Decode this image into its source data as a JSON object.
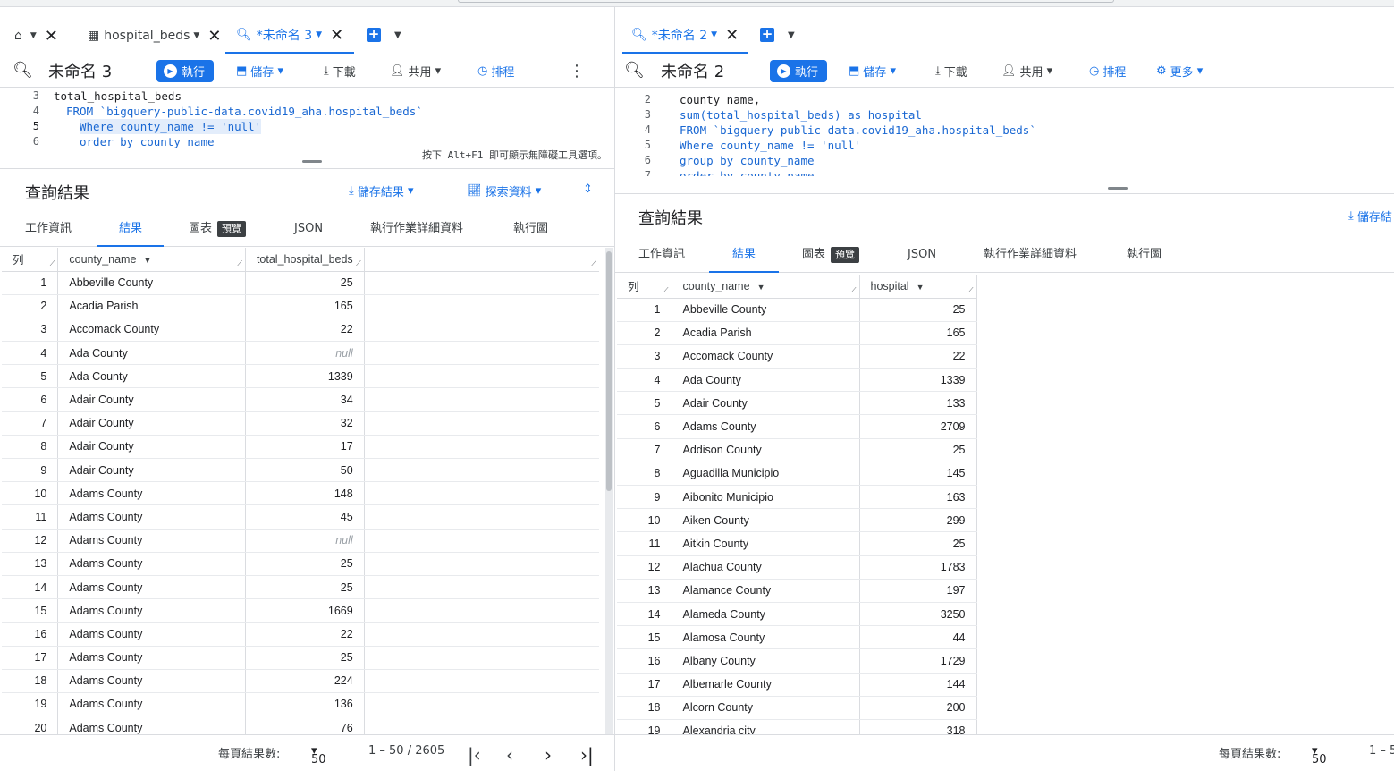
{
  "left": {
    "tabs": [
      {
        "label": "hospital_beds"
      },
      {
        "label": "*未命名 3"
      }
    ],
    "query_title": "未命名 3",
    "toolbar": {
      "run": "執行",
      "save": "儲存",
      "download": "下載",
      "share": "共用",
      "schedule": "排程"
    },
    "code": [
      {
        "n": "3",
        "t": "total_hospital_beds"
      },
      {
        "n": "4",
        "t": "FROM `bigquery-public-data.covid19_aha.hospital_beds`"
      },
      {
        "n": "5",
        "t": "Where county_name != 'null'"
      },
      {
        "n": "6",
        "t": "order by county_name"
      }
    ],
    "hint": "按下 Alt+F1 即可顯示無障礙工具選項。",
    "results_title": "查詢結果",
    "save_results": "儲存結果",
    "explore": "探索資料",
    "result_tabs": [
      "工作資訊",
      "結果",
      "圖表",
      "JSON",
      "執行作業詳細資料",
      "執行圖"
    ],
    "badge": "預覽",
    "columns": [
      "列",
      "county_name",
      "total_hospital_beds"
    ],
    "rows": [
      [
        "1",
        "Abbeville County",
        "25"
      ],
      [
        "2",
        "Acadia Parish",
        "165"
      ],
      [
        "3",
        "Accomack County",
        "22"
      ],
      [
        "4",
        "Ada County",
        "null"
      ],
      [
        "5",
        "Ada County",
        "1339"
      ],
      [
        "6",
        "Adair County",
        "34"
      ],
      [
        "7",
        "Adair County",
        "32"
      ],
      [
        "8",
        "Adair County",
        "17"
      ],
      [
        "9",
        "Adair County",
        "50"
      ],
      [
        "10",
        "Adams County",
        "148"
      ],
      [
        "11",
        "Adams County",
        "45"
      ],
      [
        "12",
        "Adams County",
        "null"
      ],
      [
        "13",
        "Adams County",
        "25"
      ],
      [
        "14",
        "Adams County",
        "25"
      ],
      [
        "15",
        "Adams County",
        "1669"
      ],
      [
        "16",
        "Adams County",
        "22"
      ],
      [
        "17",
        "Adams County",
        "25"
      ],
      [
        "18",
        "Adams County",
        "224"
      ],
      [
        "19",
        "Adams County",
        "136"
      ],
      [
        "20",
        "Adams County",
        "76"
      ]
    ],
    "footer": {
      "per_page_label": "每頁結果數:",
      "per_page": "50",
      "range": "1 – 50 / 2605"
    }
  },
  "right": {
    "tab": "*未命名 2",
    "query_title": "未命名 2",
    "toolbar": {
      "run": "執行",
      "save": "儲存",
      "download": "下載",
      "share": "共用",
      "schedule": "排程",
      "more": "更多"
    },
    "code": [
      {
        "n": "2",
        "t": "county_name,"
      },
      {
        "n": "3",
        "t": "sum(total_hospital_beds) as hospital"
      },
      {
        "n": "4",
        "t": "FROM `bigquery-public-data.covid19_aha.hospital_beds`"
      },
      {
        "n": "5",
        "t": "Where county_name != 'null'"
      },
      {
        "n": "6",
        "t": "group by county_name"
      },
      {
        "n": "7",
        "t": "order by county_name"
      }
    ],
    "results_title": "查詢結果",
    "save_results": "儲存結",
    "result_tabs": [
      "工作資訊",
      "結果",
      "圖表",
      "JSON",
      "執行作業詳細資料",
      "執行圖"
    ],
    "badge": "預覽",
    "columns": [
      "列",
      "county_name",
      "hospital"
    ],
    "rows": [
      [
        "1",
        "Abbeville County",
        "25"
      ],
      [
        "2",
        "Acadia Parish",
        "165"
      ],
      [
        "3",
        "Accomack County",
        "22"
      ],
      [
        "4",
        "Ada County",
        "1339"
      ],
      [
        "5",
        "Adair County",
        "133"
      ],
      [
        "6",
        "Adams County",
        "2709"
      ],
      [
        "7",
        "Addison County",
        "25"
      ],
      [
        "8",
        "Aguadilla Municipio",
        "145"
      ],
      [
        "9",
        "Aibonito Municipio",
        "163"
      ],
      [
        "10",
        "Aiken County",
        "299"
      ],
      [
        "11",
        "Aitkin County",
        "25"
      ],
      [
        "12",
        "Alachua County",
        "1783"
      ],
      [
        "13",
        "Alamance County",
        "197"
      ],
      [
        "14",
        "Alameda County",
        "3250"
      ],
      [
        "15",
        "Alamosa County",
        "44"
      ],
      [
        "16",
        "Albany County",
        "1729"
      ],
      [
        "17",
        "Albemarle County",
        "144"
      ],
      [
        "18",
        "Alcorn County",
        "200"
      ],
      [
        "19",
        "Alexandria city",
        "318"
      ]
    ],
    "footer": {
      "per_page_label": "每頁結果數:",
      "per_page": "50",
      "range": "1 – 5"
    }
  },
  "colors": {
    "accent": "#1a73e8",
    "border": "#dadce0"
  }
}
